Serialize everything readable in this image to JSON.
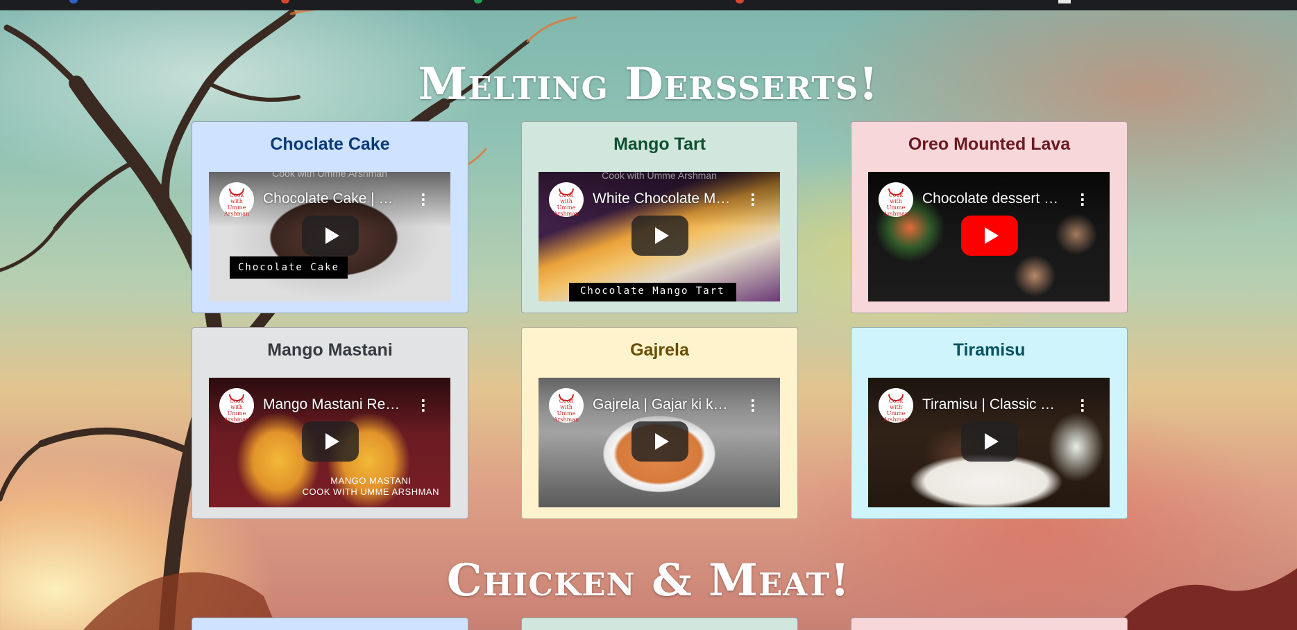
{
  "sections": [
    {
      "title": "Melting Dersserts!"
    },
    {
      "title": "Chicken & Meat!"
    }
  ],
  "desserts": [
    {
      "heading": "Choclate Cake",
      "bg": "#cfe2ff",
      "heading_color": "#0a3a78",
      "video_title": "Chocolate Cake | Chocolate Cake Recipe",
      "channel_text": "Cook with Umme Arshman",
      "caption": "Chocolate Cake",
      "red_play": false
    },
    {
      "heading": "Mango Tart",
      "bg": "#d1e7dd",
      "heading_color": "#0f5132",
      "video_title": "White Chocolate Mango Tart",
      "channel_text": "Cook with Umme Arshman",
      "caption": "Chocolate Mango Tart",
      "red_play": false
    },
    {
      "heading": "Oreo Mounted Lava",
      "bg": "#f8d7da",
      "heading_color": "#6a1a21",
      "video_title": "Chocolate dessert cups",
      "channel_text": "",
      "caption": "",
      "red_play": true
    },
    {
      "heading": "Mango Mastani",
      "bg": "#e2e3e5",
      "heading_color": "#343a40",
      "video_title": "Mango Mastani Recipe",
      "channel_text": "",
      "overlay_line1": "MANGO MASTANI",
      "overlay_line2": "COOK WITH UMME ARSHMAN",
      "red_play": false
    },
    {
      "heading": "Gajrela",
      "bg": "#fff3cd",
      "heading_color": "#664d03",
      "video_title": "Gajrela | Gajar ki kheer",
      "channel_text": "",
      "caption": "",
      "red_play": false
    },
    {
      "heading": "Tiramisu",
      "bg": "#cff4fc",
      "heading_color": "#055160",
      "video_title": "Tiramisu | Classic Tiramisu Recipe",
      "channel_text": "",
      "caption": "",
      "red_play": false
    }
  ],
  "logo_text": "Cook with Umme Arshman",
  "colors": {
    "youtube_red": "#ff0000"
  }
}
